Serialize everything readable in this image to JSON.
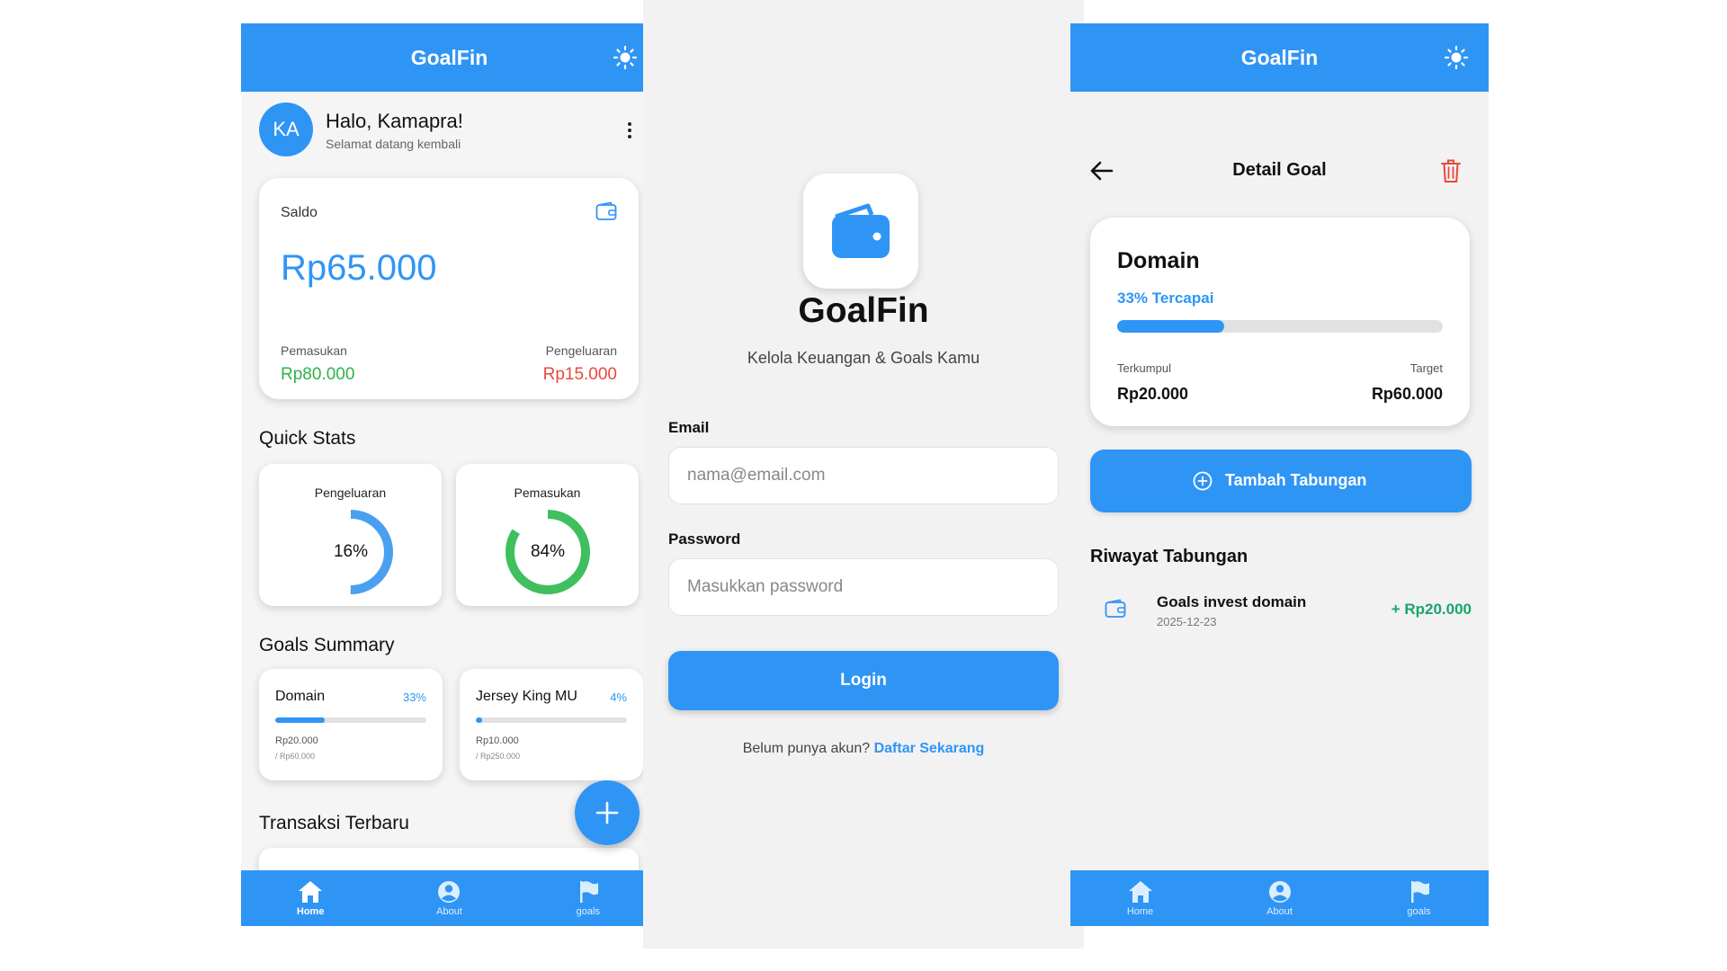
{
  "app": {
    "title": "GoalFin"
  },
  "colors": {
    "primary": "#2f95f5",
    "income": "#2fb34a",
    "expense": "#e8483b",
    "history_amount": "#19a56b",
    "track": "#e1e1e1"
  },
  "nav": [
    {
      "label": "Home",
      "icon": "home-icon"
    },
    {
      "label": "About",
      "icon": "user-circle-icon"
    },
    {
      "label": "goals",
      "icon": "flag-icon"
    }
  ],
  "home": {
    "avatar_initials": "KA",
    "greeting": "Halo, Kamapra!",
    "greeting_sub": "Selamat datang kembali",
    "balance": {
      "label": "Saldo",
      "amount": "Rp65.000",
      "income_label": "Pemasukan",
      "income_amount": "Rp80.000",
      "expense_label": "Pengeluaran",
      "expense_amount": "Rp15.000"
    },
    "quick_stats_title": "Quick Stats",
    "quick_stats": [
      {
        "title": "Pengeluaran",
        "percent_label": "16%",
        "fraction": 0.16,
        "color": "#4aa0f0"
      },
      {
        "title": "Pemasukan",
        "percent_label": "84%",
        "fraction": 0.84,
        "color": "#3fbf5e"
      }
    ],
    "goals_summary_title": "Goals Summary",
    "goals": [
      {
        "name": "Domain",
        "percent_label": "33%",
        "fraction": 0.33,
        "current": "Rp20.000",
        "target": "/ Rp60.000"
      },
      {
        "name": "Jersey King MU",
        "percent_label": "4%",
        "fraction": 0.04,
        "current": "Rp10.000",
        "target": "/ Rp250.000"
      }
    ],
    "recent_tx_title": "Transaksi Terbaru",
    "fab_icon": "plus-icon"
  },
  "login": {
    "brand": "GoalFin",
    "tagline": "Kelola Keuangan & Goals Kamu",
    "email_label": "Email",
    "email_placeholder": "nama@email.com",
    "email_value": "",
    "password_label": "Password",
    "password_placeholder": "Masukkan password",
    "password_value": "",
    "login_button": "Login",
    "signup_prompt": "Belum punya akun?",
    "signup_link": "Daftar Sekarang"
  },
  "detail": {
    "page_title": "Detail Goal",
    "goal_name": "Domain",
    "percent_label": "33% Tercapai",
    "fraction": 0.33,
    "collected_label": "Terkumpul",
    "collected_amount": "Rp20.000",
    "target_label": "Target",
    "target_amount": "Rp60.000",
    "add_button": "Tambah Tabungan",
    "history_title": "Riwayat Tabungan",
    "history": [
      {
        "name": "Goals invest domain",
        "date": "2025-12-23",
        "amount": "+ Rp20.000"
      }
    ]
  }
}
